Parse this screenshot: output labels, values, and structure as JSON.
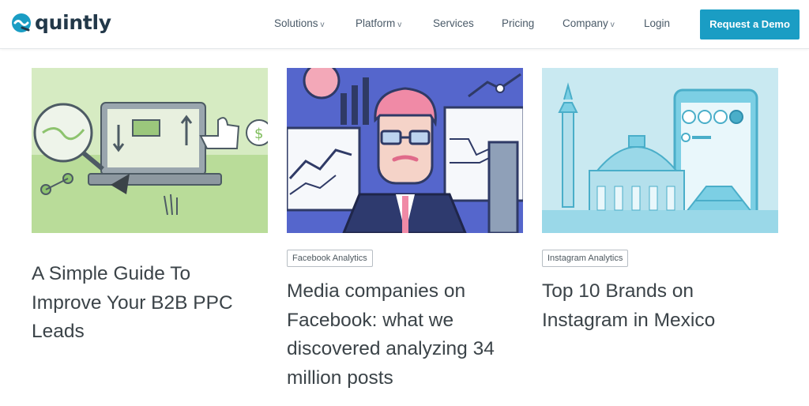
{
  "header": {
    "brand": "quintly",
    "nav": [
      {
        "label": "Solutions",
        "caret": "v"
      },
      {
        "label": "Platform",
        "caret": "v"
      },
      {
        "label": "Services",
        "caret": ""
      },
      {
        "label": "Pricing",
        "caret": ""
      },
      {
        "label": "Company",
        "caret": "v"
      },
      {
        "label": "Login",
        "caret": ""
      }
    ],
    "cta": "Request a Demo"
  },
  "cards": [
    {
      "tag": "",
      "title": "A Simple Guide To Improve Your B2B PPC Leads"
    },
    {
      "tag": "Facebook Analytics",
      "title": "Media companies on Facebook: what we discovered analyzing 34 million posts"
    },
    {
      "tag": "Instagram Analytics",
      "title": "Top 10 Brands on Instagram in Mexico"
    }
  ],
  "colors": {
    "accent": "#1a9dc4",
    "brand_text": "#223849",
    "card1_bg": "#c8e2b0",
    "card2_bg": "#5566cc",
    "card3_bg": "#c9e9f1"
  }
}
